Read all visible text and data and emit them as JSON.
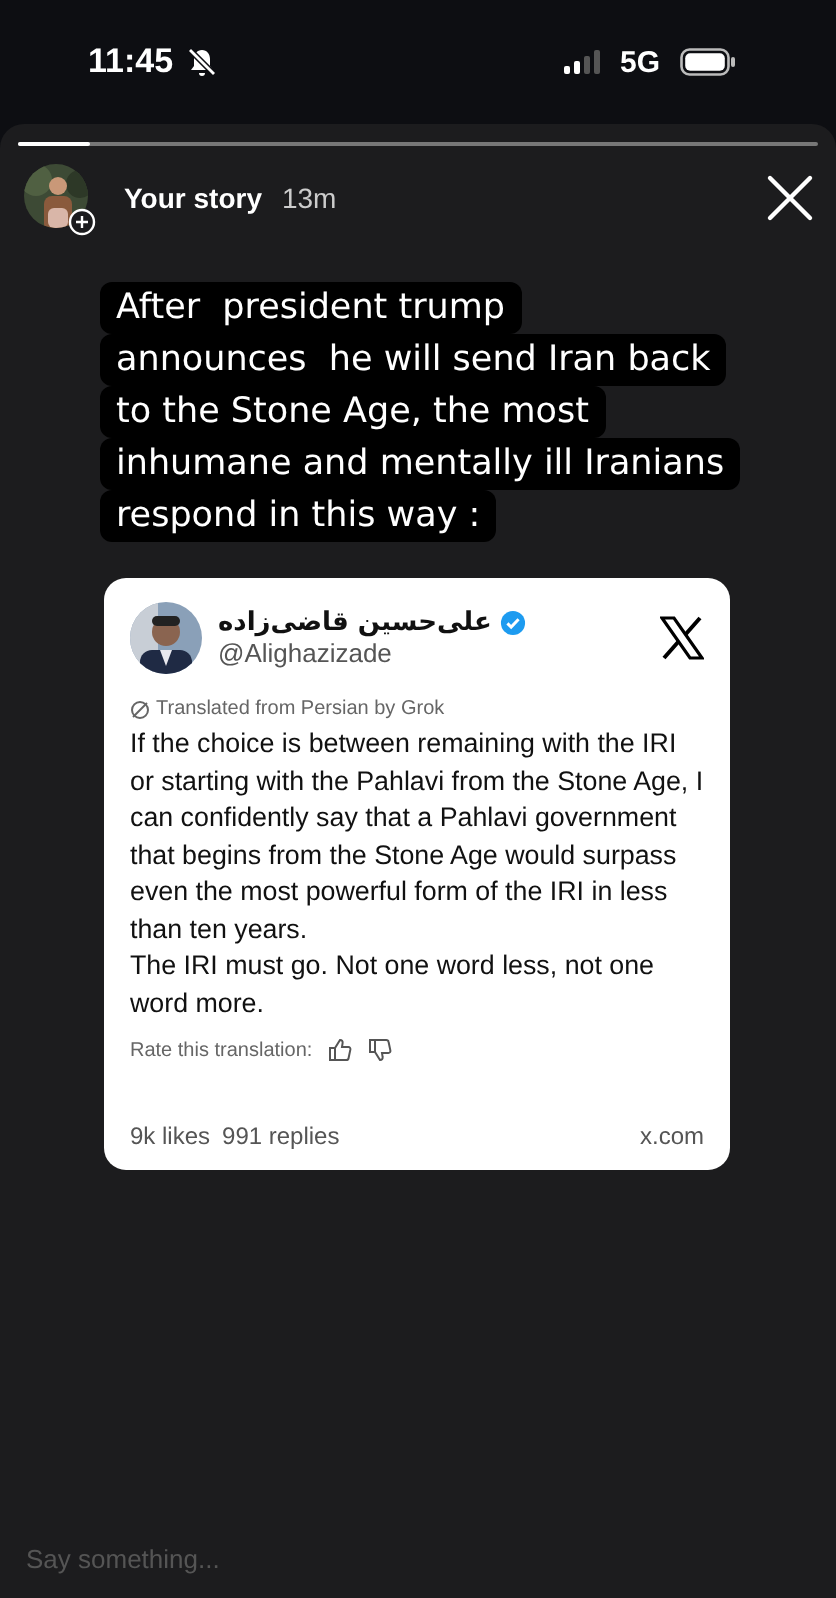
{
  "status_bar": {
    "time": "11:45",
    "network": "5G",
    "silent": true
  },
  "story": {
    "progress": {
      "level": 0.09
    },
    "author": "Your story",
    "time": "13m"
  },
  "caption": [
    "After  president trump",
    "announces  he will send Iran back",
    "to the Stone Age, the most",
    "inhumane and mentally ill Iranians",
    "respond in this way :"
  ],
  "post": {
    "name": "علی‌حسین قاضی‌زاده",
    "verified": true,
    "handle": "@Alighazizade",
    "translation_note": "Translated from Persian by Grok",
    "paragraphs": [
      "If the choice is between remaining with the IRI or starting with the Pahlavi from the Stone Age, I can confidently say that a Pahlavi government that begins from the Stone Age would surpass even the most powerful form of the IRI in less than ten years.",
      "The IRI must go. Not one word less, not one word more."
    ],
    "rate_label": "Rate this translation:",
    "likes": "9k likes",
    "replies": "991 replies",
    "source": "x.com"
  },
  "reply": {
    "placeholder": "Say something..."
  }
}
